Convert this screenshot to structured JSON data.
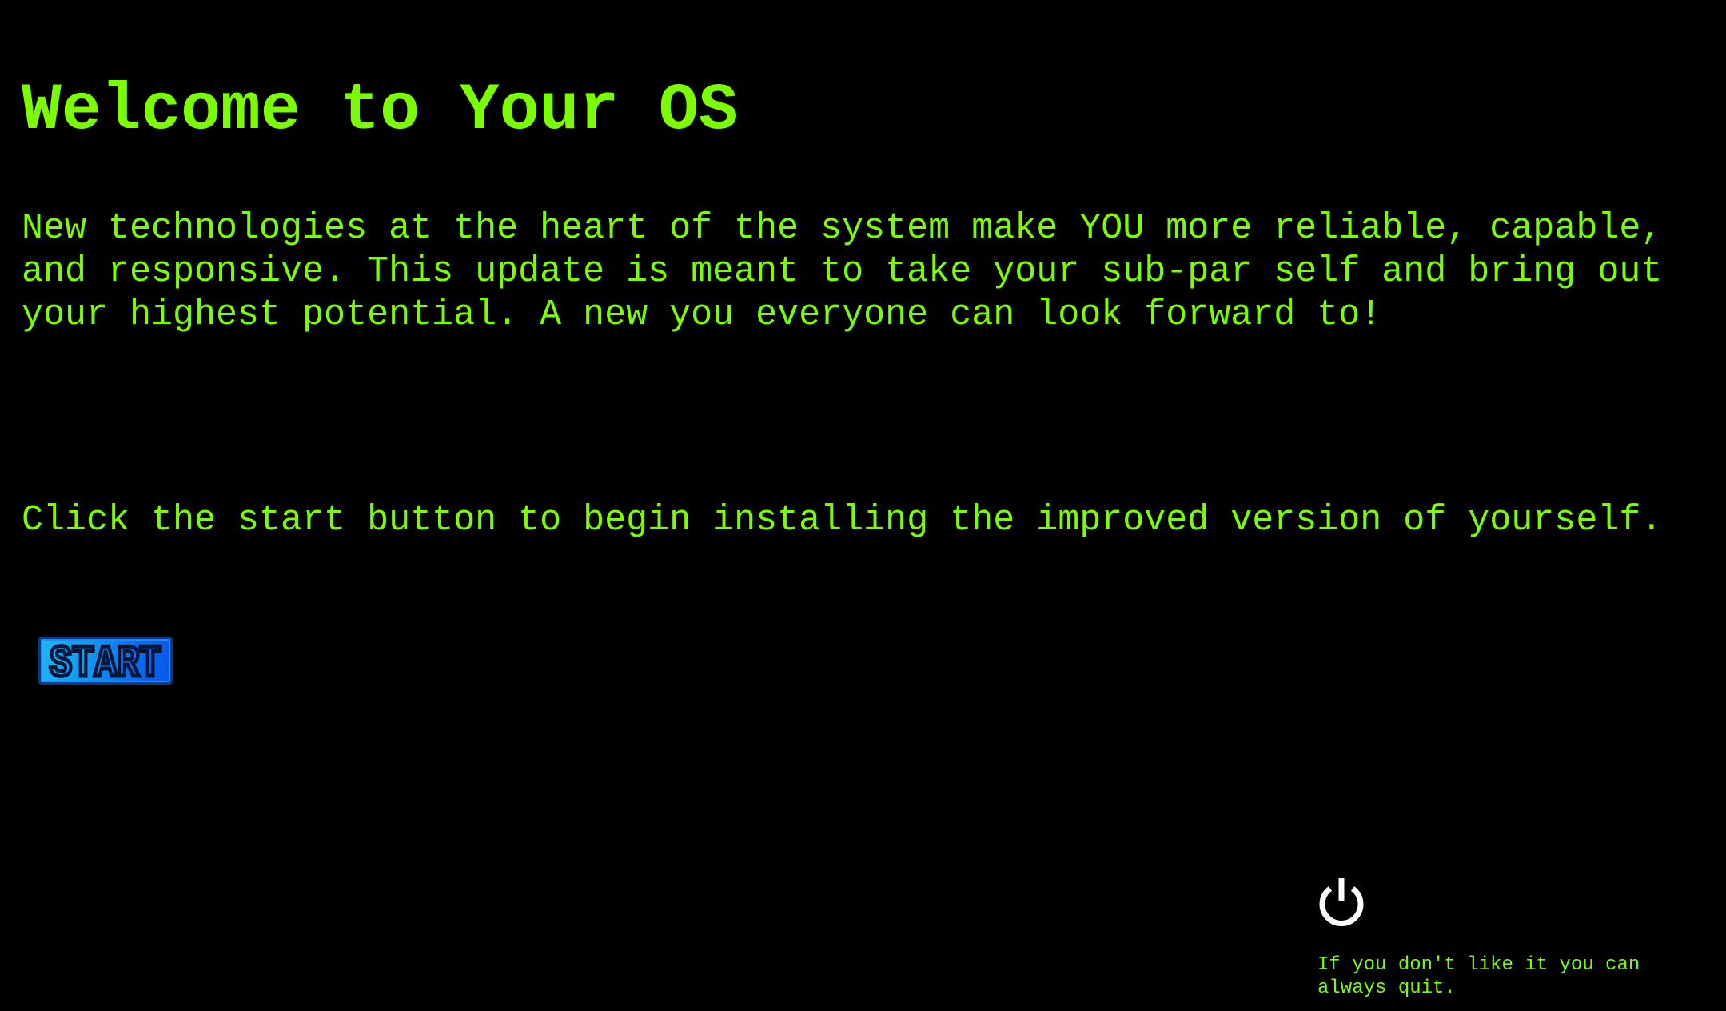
{
  "page": {
    "title": "Welcome to Your OS",
    "intro": "New technologies at the heart of the system make YOU more reliable, capable, and responsive. This update is meant to take your sub-par self and bring out your highest potential. A new you everyone can look forward to!",
    "instruction": "Click the start button to begin installing the improved version of yourself.",
    "start_label": "START",
    "quit_note": "If you don't like it you can always quit."
  },
  "icons": {
    "power": "power-icon"
  },
  "colors": {
    "background": "#000000",
    "text": "#7cfc00",
    "start_button": "#0f9cf0",
    "power_icon": "#ffffff"
  }
}
